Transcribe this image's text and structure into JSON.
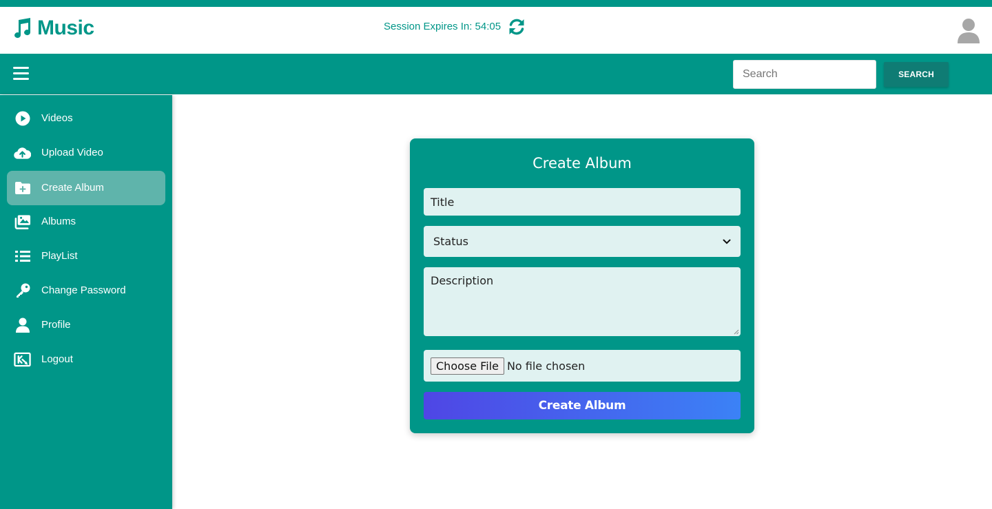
{
  "brand": {
    "name": "Music",
    "icon": "music-note-icon"
  },
  "session": {
    "label": "Session Expires In: 54:05",
    "refresh_icon": "refresh-icon"
  },
  "user": {
    "avatar_icon": "user-avatar-icon"
  },
  "navbar": {
    "menu_icon": "hamburger-menu-icon",
    "search_placeholder": "Search",
    "search_button": "SEARCH"
  },
  "sidebar": {
    "items": [
      {
        "label": "Videos",
        "icon": "play-circle-icon",
        "active": false
      },
      {
        "label": "Upload Video",
        "icon": "cloud-upload-icon",
        "active": false
      },
      {
        "label": "Create Album",
        "icon": "folder-plus-icon",
        "active": true
      },
      {
        "label": "Albums",
        "icon": "images-icon",
        "active": false
      },
      {
        "label": "PlayList",
        "icon": "list-icon",
        "active": false
      },
      {
        "label": "Change Password",
        "icon": "key-icon",
        "active": false
      },
      {
        "label": "Profile",
        "icon": "user-icon",
        "active": false
      },
      {
        "label": "Logout",
        "icon": "logout-icon",
        "active": false
      }
    ]
  },
  "form": {
    "title": "Create Album",
    "title_placeholder": "Title",
    "status_selected": "Status",
    "description_placeholder": "Description",
    "file_button": "Choose File",
    "file_status": "No file chosen",
    "submit": "Create Album"
  },
  "colors": {
    "primary": "#009688",
    "active_item": "#5fb4ab",
    "field_bg": "#e0f2f1",
    "gradient_start": "#4f46e5",
    "gradient_end": "#3b82f6"
  }
}
